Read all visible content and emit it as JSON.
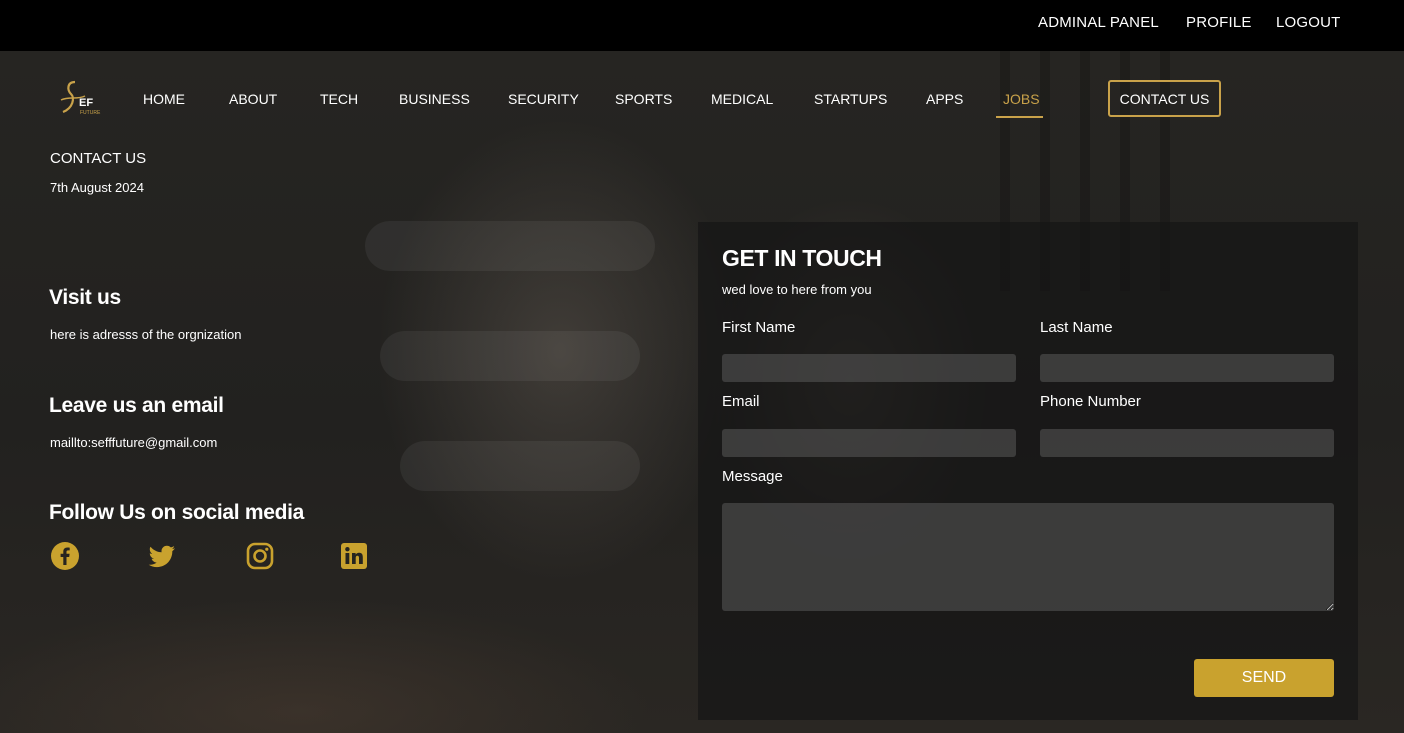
{
  "topbar": {
    "admin_label": "ADMINAL PANEL",
    "profile_label": "PROFILE",
    "logout_label": "LOGOUT"
  },
  "logo": {
    "text": "EF",
    "subtext": "FUTURE"
  },
  "nav": {
    "items": [
      {
        "label": "HOME"
      },
      {
        "label": "ABOUT"
      },
      {
        "label": "TECH"
      },
      {
        "label": "BUSINESS"
      },
      {
        "label": "SECURITY"
      },
      {
        "label": "SPORTS"
      },
      {
        "label": "MEDICAL"
      },
      {
        "label": "STARTUPS"
      },
      {
        "label": "APPS"
      },
      {
        "label": "JOBS"
      }
    ],
    "active": "JOBS",
    "contact_label": "CONTACT US"
  },
  "page": {
    "heading": "CONTACT US",
    "date": "7th August 2024"
  },
  "info": {
    "visit_title": "Visit us",
    "visit_text": "here is adresss of the orgnization",
    "email_title": "Leave us an email",
    "email_text": "maillto:sefffuture@gmail.com",
    "social_title": "Follow Us on social media",
    "social_icons": [
      "facebook-icon",
      "twitter-icon",
      "instagram-icon",
      "linkedin-icon"
    ]
  },
  "form": {
    "title": "GET IN TOUCH",
    "subtitle": "wed love to here from you",
    "first_name_label": "First Name",
    "first_name_value": "",
    "last_name_label": "Last Name",
    "last_name_value": "",
    "email_label": "Email",
    "email_value": "",
    "phone_label": "Phone Number",
    "phone_value": "",
    "message_label": "Message",
    "message_value": "",
    "send_label": "SEND"
  },
  "colors": {
    "accent": "#c9a24a",
    "button": "#c9a22e",
    "topbar": "#000000"
  }
}
